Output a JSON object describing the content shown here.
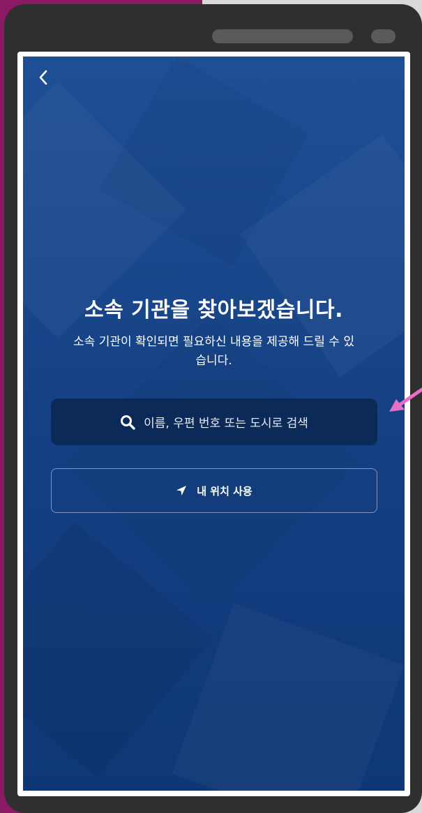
{
  "screen": {
    "headline": "소속 기관을 찾아보겠습니다.",
    "subtext": "소속 기관이 확인되면 필요하신 내용을 제공해 드릴 수 있습니다.",
    "search_button": {
      "label": "이름, 우편 번호 또는 도시로 검색",
      "icon": "search-icon"
    },
    "location_button": {
      "label": "내 위치 사용",
      "icon": "location-arrow-icon"
    },
    "back_icon": "chevron-left-icon"
  },
  "colors": {
    "background_top": "#1e4f95",
    "background_bottom": "#0f3775",
    "search_button_bg": "#0c2a57",
    "location_button_border": "#7d97c0",
    "annotation_arrow": "#e86fc9"
  }
}
